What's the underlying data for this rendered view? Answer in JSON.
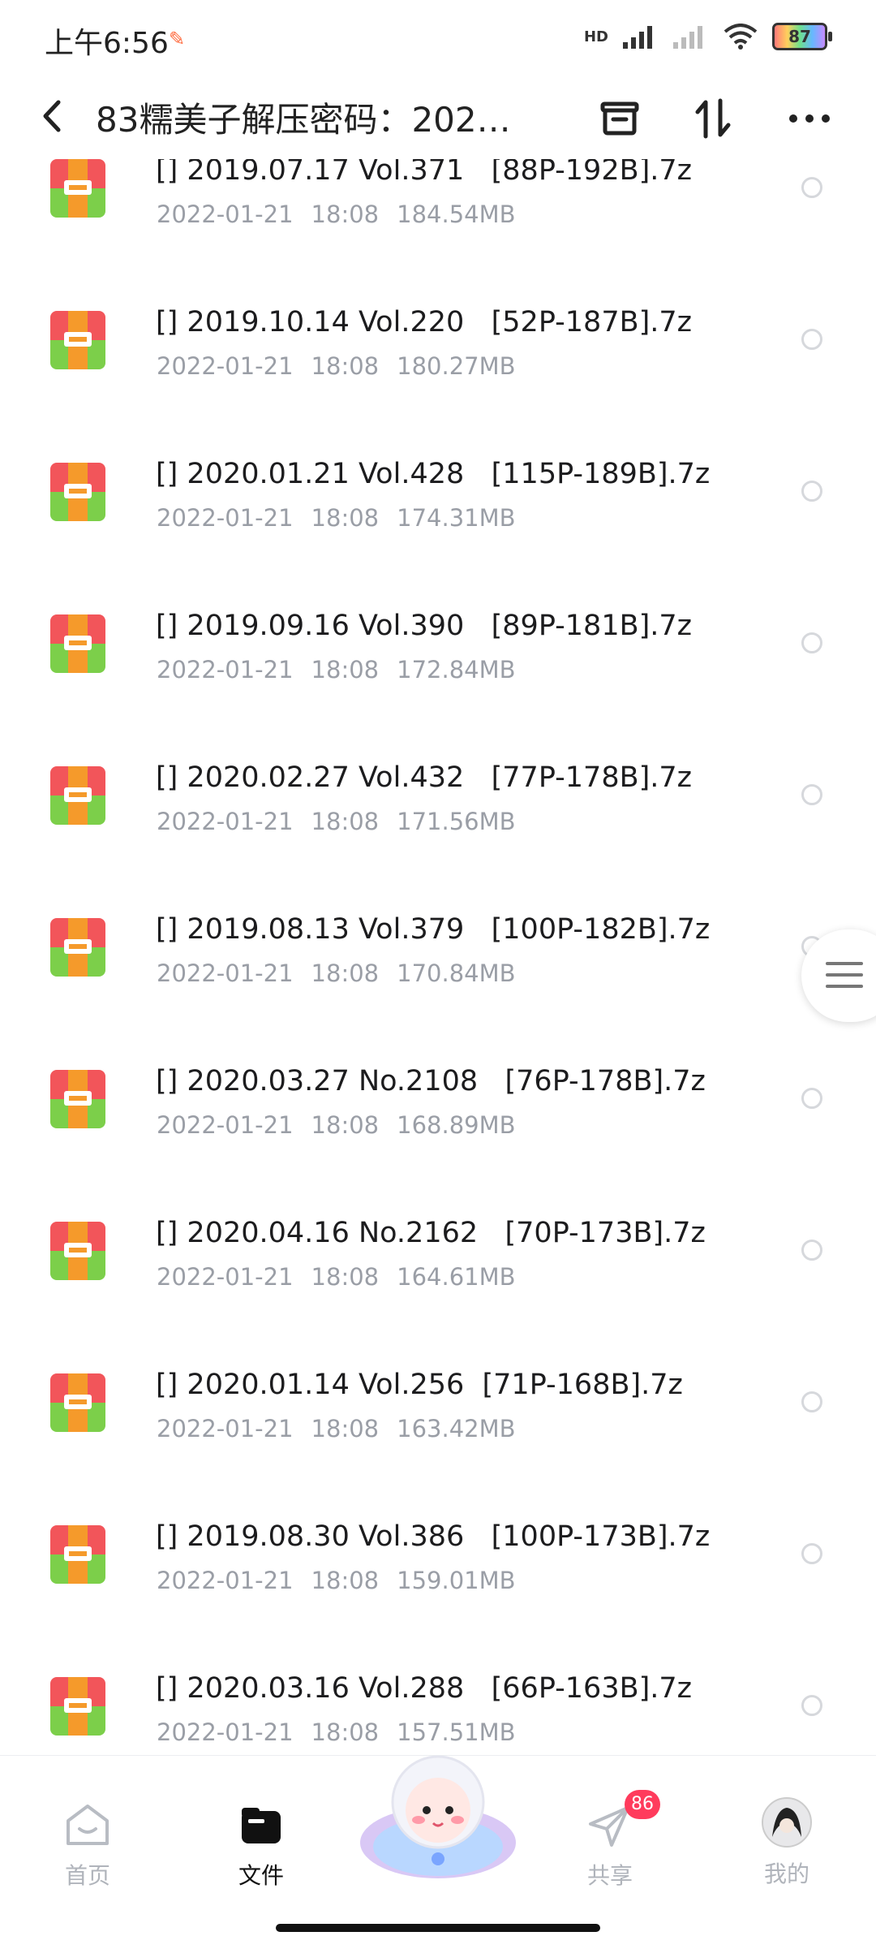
{
  "status_bar": {
    "time": "上午6:56",
    "extra_icon": "nfc-icon",
    "network": "HD",
    "battery": "87"
  },
  "header": {
    "title": "83糯美子解压密码：202…",
    "back_icon": "chevron-left-icon",
    "icons": [
      "archive-box-icon",
      "sort-arrows-icon",
      "more-dots-icon"
    ]
  },
  "files": [
    {
      "name": "[] 2019.07.17 Vol.371   [88P-192B].7z",
      "date": "2022-01-21",
      "time": "18:08",
      "size": "184.54MB"
    },
    {
      "name": "[] 2019.10.14 Vol.220   [52P-187B].7z",
      "date": "2022-01-21",
      "time": "18:08",
      "size": "180.27MB"
    },
    {
      "name": "[] 2020.01.21 Vol.428   [115P-189B].7z",
      "date": "2022-01-21",
      "time": "18:08",
      "size": "174.31MB"
    },
    {
      "name": "[] 2019.09.16 Vol.390   [89P-181B].7z",
      "date": "2022-01-21",
      "time": "18:08",
      "size": "172.84MB"
    },
    {
      "name": "[] 2020.02.27 Vol.432   [77P-178B].7z",
      "date": "2022-01-21",
      "time": "18:08",
      "size": "171.56MB"
    },
    {
      "name": "[] 2019.08.13 Vol.379   [100P-182B].7z",
      "date": "2022-01-21",
      "time": "18:08",
      "size": "170.84MB"
    },
    {
      "name": "[] 2020.03.27 No.2108   [76P-178B].7z",
      "date": "2022-01-21",
      "time": "18:08",
      "size": "168.89MB"
    },
    {
      "name": "[] 2020.04.16 No.2162   [70P-173B].7z",
      "date": "2022-01-21",
      "time": "18:08",
      "size": "164.61MB"
    },
    {
      "name": "[] 2020.01.14 Vol.256  [71P-168B].7z",
      "date": "2022-01-21",
      "time": "18:08",
      "size": "163.42MB"
    },
    {
      "name": "[] 2019.08.30 Vol.386   [100P-173B].7z",
      "date": "2022-01-21",
      "time": "18:08",
      "size": "159.01MB"
    },
    {
      "name": "[] 2020.03.16 Vol.288   [66P-163B].7z",
      "date": "2022-01-21",
      "time": "18:08",
      "size": "157.51MB"
    }
  ],
  "bottom_nav": {
    "home": "首页",
    "files": "文件",
    "share": "共享",
    "share_badge": "86",
    "mine": "我的"
  },
  "colors": {
    "accent": "#111111",
    "badge": "#ff3b5c",
    "meta_text": "#9a9ea6",
    "archive_top": "#f2555a",
    "archive_bottom": "#7ccf4a",
    "archive_band": "#f59a2b"
  }
}
